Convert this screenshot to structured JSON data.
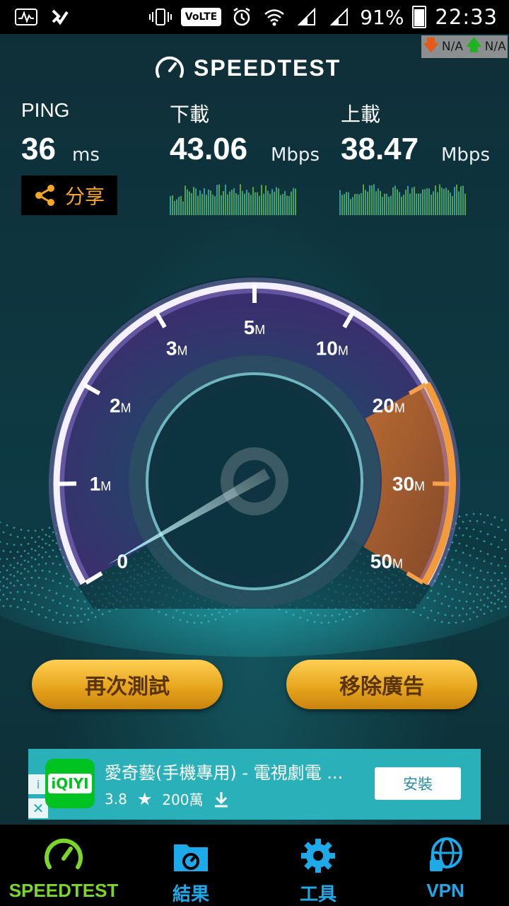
{
  "status_bar": {
    "volte": "VoLTE",
    "battery_percent": "91%",
    "time": "22:33"
  },
  "na_indicator": {
    "down": "N/A",
    "up": "N/A"
  },
  "header": {
    "logo_text": "SPEEDTEST"
  },
  "stats": {
    "ping": {
      "label": "PING",
      "value": "36",
      "unit": "ms"
    },
    "download": {
      "label": "下載",
      "value": "43.06",
      "unit": "Mbps"
    },
    "upload": {
      "label": "上載",
      "value": "38.47",
      "unit": "Mbps"
    }
  },
  "share_button": {
    "label": "分享"
  },
  "gauge": {
    "ticks": [
      {
        "num": "0",
        "suffix": ""
      },
      {
        "num": "1",
        "suffix": "M"
      },
      {
        "num": "2",
        "suffix": "M"
      },
      {
        "num": "3",
        "suffix": "M"
      },
      {
        "num": "5",
        "suffix": "M"
      },
      {
        "num": "10",
        "suffix": "M"
      },
      {
        "num": "20",
        "suffix": "M"
      },
      {
        "num": "30",
        "suffix": "M"
      },
      {
        "num": "50",
        "suffix": "M"
      }
    ]
  },
  "buttons": {
    "retest": "再次測試",
    "remove_ads": "移除廣告"
  },
  "ad": {
    "app_logo": "iQIYI",
    "title": "愛奇藝(手機專用) - 電視劇電 ...",
    "rating": "3.8",
    "downloads": "200萬",
    "install_label": "安裝",
    "info_label": "i",
    "close_label": "✕"
  },
  "bottom_nav": [
    {
      "label": "SPEEDTEST",
      "icon": "speedometer-icon",
      "active": true,
      "color": "#7cd62a"
    },
    {
      "label": "結果",
      "icon": "results-folder-icon",
      "active": false,
      "color": "#1ea9e8"
    },
    {
      "label": "工具",
      "icon": "gear-icon",
      "active": false,
      "color": "#1ea9e8"
    },
    {
      "label": "VPN",
      "icon": "vpn-globe-lock-icon",
      "active": false,
      "color": "#1ea9e8"
    }
  ],
  "colors": {
    "accent_orange": "#f5a623",
    "active_green": "#7cd62a",
    "nav_blue": "#1ea9e8",
    "ad_bg": "#2ab0b8"
  }
}
